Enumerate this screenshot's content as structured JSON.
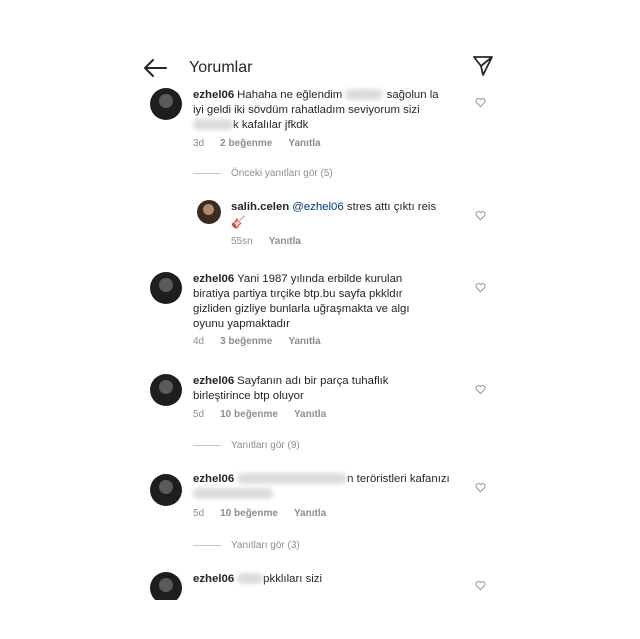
{
  "header": {
    "title": "Yorumlar",
    "back_icon": "arrow-left-icon",
    "send_icon": "paper-plane-icon"
  },
  "comments": [
    {
      "username": "ezhel06",
      "line1": "Hahaha ne eğlendim",
      "line1b": "sağolun la",
      "line2": "iyi geldi iki sövdüm rahatladım seviyorum sizi",
      "line3": "k kafalılar jfkdk",
      "time": "3d",
      "likes": "2 beğenme",
      "reply": "Yanıtla"
    },
    {
      "view_previous": "Önceki yanıtları gör (5)"
    },
    {
      "username": "salih.celen",
      "mention": "@ezhel06",
      "text": "stres attı çıktı reis",
      "emoji": "🎸",
      "time": "55sn",
      "reply": "Yanıtla"
    },
    {
      "username": "ezhel06",
      "line1": "Yani 1987 yılında erbilde kurulan",
      "line2": "biratiya partiya tırçike btp.bu sayfa pkkldır",
      "line3": "gizliden gizliye bunlarla uğraşmakta ve algı",
      "line4": "oyunu yapmaktadır",
      "time": "4d",
      "likes": "3 beğenme",
      "reply": "Yanıtla"
    },
    {
      "username": "ezhel06",
      "line1": "Sayfanın adı bir parça tuhaflık",
      "line2": "birleştirince btp oluyor",
      "time": "5d",
      "likes": "10 beğenme",
      "reply": "Yanıtla",
      "view_replies": "Yanıtları gör (9)"
    },
    {
      "username": "ezhel06",
      "line1": "n teröristleri kafanızı",
      "time": "5d",
      "likes": "10 beğenme",
      "reply": "Yanıtla",
      "view_replies": "Yanıtları gör (3)"
    },
    {
      "username": "ezhel06",
      "line1": "pkklıları sizi"
    }
  ]
}
